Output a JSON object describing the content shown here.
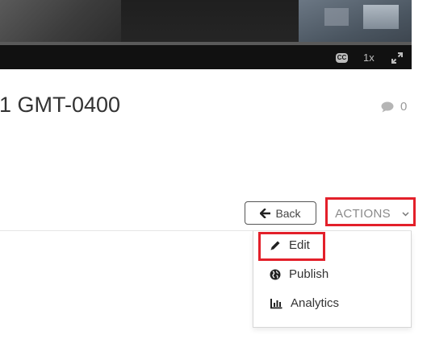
{
  "video": {
    "cc_label": "CC",
    "speed_label": "1x"
  },
  "page": {
    "title": "1 GMT-0400",
    "comment_count": "0"
  },
  "toolbar": {
    "back_label": "Back",
    "actions_label": "ACTIONS"
  },
  "actions_menu": {
    "items": [
      {
        "label": "Edit",
        "icon": "pencil-icon"
      },
      {
        "label": "Publish",
        "icon": "globe-icon"
      },
      {
        "label": "Analytics",
        "icon": "bar-chart-icon"
      }
    ]
  },
  "colors": {
    "highlight": "#e3202a",
    "text": "#333333",
    "muted": "#9a9a9a"
  }
}
